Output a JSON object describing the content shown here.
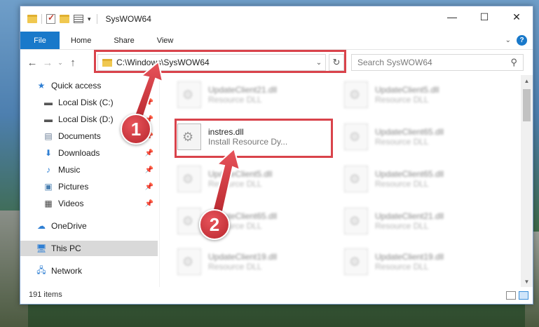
{
  "window": {
    "title": "SysWOW64"
  },
  "window_controls": {
    "minimize": "—",
    "maximize": "☐",
    "close": "✕"
  },
  "ribbon": {
    "file": "File",
    "tabs": [
      "Home",
      "Share",
      "View"
    ],
    "help": "?"
  },
  "address": {
    "path": "C:\\Windows\\SysWOW64"
  },
  "search": {
    "placeholder": "Search SysWOW64"
  },
  "nav": {
    "items": [
      {
        "label": "Quick access",
        "icon": "star-icon",
        "pinned": false
      },
      {
        "label": "Local Disk (C:)",
        "icon": "drive-icon",
        "pinned": true
      },
      {
        "label": "Local Disk (D:)",
        "icon": "drive-icon",
        "pinned": true
      },
      {
        "label": "Documents",
        "icon": "documents-icon",
        "pinned": true
      },
      {
        "label": "Downloads",
        "icon": "download-icon",
        "pinned": true
      },
      {
        "label": "Music",
        "icon": "music-icon",
        "pinned": true
      },
      {
        "label": "Pictures",
        "icon": "pictures-icon",
        "pinned": true
      },
      {
        "label": "Videos",
        "icon": "videos-icon",
        "pinned": true
      },
      {
        "label": "OneDrive",
        "icon": "cloud-icon",
        "pinned": false
      },
      {
        "label": "This PC",
        "icon": "computer-icon",
        "pinned": false,
        "selected": true
      },
      {
        "label": "Network",
        "icon": "network-icon",
        "pinned": false
      }
    ]
  },
  "files": {
    "highlighted": {
      "name": "instres.dll",
      "description": "Install Resource Dy..."
    },
    "left_column": [
      {
        "name": "UpdateClient21.dll",
        "description": "Resource DLL"
      },
      {
        "name": "UpdateClient5.dll",
        "description": "Resource DLL"
      },
      {
        "name": "UpdateClient65.dll",
        "description": "Resource DLL"
      },
      {
        "name": "UpdateClient19.dll",
        "description": "Resource DLL"
      }
    ],
    "right_column": [
      {
        "name": "UpdateClient5.dll",
        "description": "Resource DLL"
      },
      {
        "name": "UpdateClient65.dll",
        "description": "Resource DLL"
      },
      {
        "name": "UpdateClient65.dll",
        "description": "Resource DLL"
      },
      {
        "name": "UpdateClient21.dll",
        "description": "Resource DLL"
      },
      {
        "name": "UpdateClient19.dll",
        "description": "Resource DLL"
      }
    ]
  },
  "status": {
    "item_count": "191 items"
  },
  "callouts": {
    "step1": "1",
    "step2": "2"
  },
  "colors": {
    "accent": "#1979ca",
    "highlight": "#d9434b"
  }
}
